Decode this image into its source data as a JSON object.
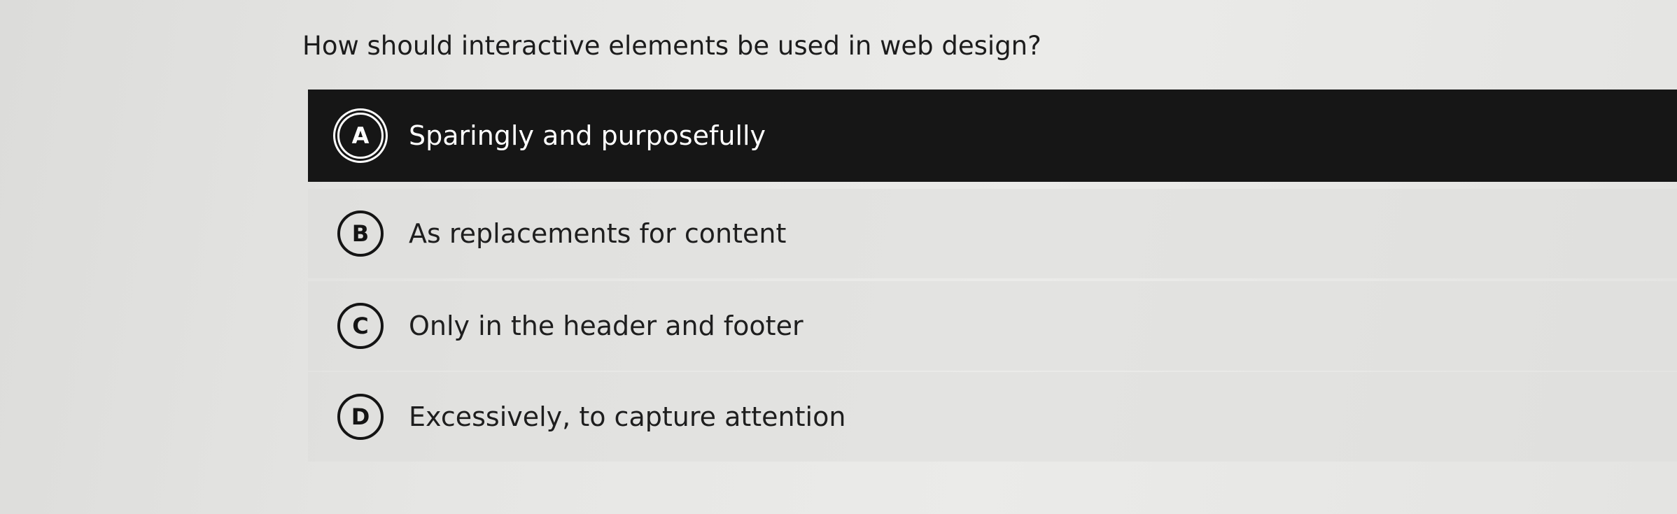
{
  "question": "How should interactive elements be used in web design?",
  "options": [
    {
      "letter": "A",
      "text": "Sparingly and purposefully",
      "selected": true
    },
    {
      "letter": "B",
      "text": "As replacements for content",
      "selected": false
    },
    {
      "letter": "C",
      "text": "Only in the header and footer",
      "selected": false
    },
    {
      "letter": "D",
      "text": "Excessively, to capture attention",
      "selected": false
    }
  ],
  "colors": {
    "selected_background": "#161616",
    "selected_text": "#ffffff",
    "text": "#1e1e1e",
    "page_background": "#e6e6e4"
  }
}
